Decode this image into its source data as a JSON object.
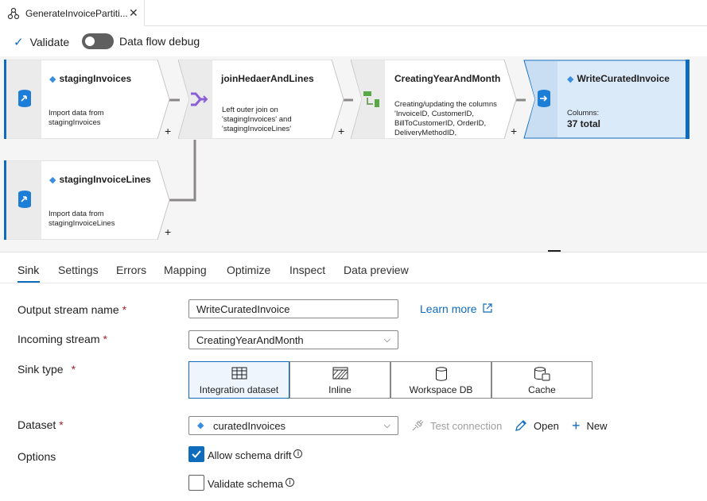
{
  "tab": {
    "title": "GenerateInvoicePartiti...",
    "close": "✕"
  },
  "toolbar": {
    "validate_label": "Validate",
    "debug_label": "Data flow debug"
  },
  "nodes": {
    "staging_invoices": {
      "title": "stagingInvoices",
      "desc": "Import data from stagingInvoices"
    },
    "join": {
      "title": "joinHedaerAndLines",
      "desc": "Left outer join on 'stagingInvoices' and 'stagingInvoiceLines'"
    },
    "derive": {
      "title": "CreatingYearAndMonth",
      "desc": "Creating/updating the columns 'InvoiceID, CustomerID, BillToCustomerID, OrderID, DeliveryMethodID,"
    },
    "sink": {
      "title": "WriteCuratedInvoice",
      "columns_label": "Columns:",
      "columns_value": "37 total"
    },
    "staging_lines": {
      "title": "stagingInvoiceLines",
      "desc": "Import data from stagingInvoiceLines"
    },
    "plus": "+"
  },
  "tabs": [
    "Sink",
    "Settings",
    "Errors",
    "Mapping",
    "Optimize",
    "Inspect",
    "Data preview"
  ],
  "form": {
    "output_stream": {
      "label": "Output stream name",
      "value": "WriteCuratedInvoice",
      "learn_more": "Learn more"
    },
    "incoming_stream": {
      "label": "Incoming stream",
      "value": "CreatingYearAndMonth"
    },
    "sink_type": {
      "label": "Sink type",
      "options": [
        "Integration dataset",
        "Inline",
        "Workspace DB",
        "Cache"
      ],
      "selected": "Integration dataset"
    },
    "dataset": {
      "label": "Dataset",
      "value": "curatedInvoices",
      "test_connection": "Test connection",
      "open": "Open",
      "new": "New"
    },
    "options": {
      "label": "Options",
      "allow_schema_drift": "Allow schema drift",
      "allow_checked": true,
      "validate_schema": "Validate schema",
      "validate_checked": false
    }
  },
  "required_marker": "*",
  "colors": {
    "accent": "#0f6cbd",
    "node_selected_bg": "#dbeaf8",
    "required": "#a4262c"
  }
}
